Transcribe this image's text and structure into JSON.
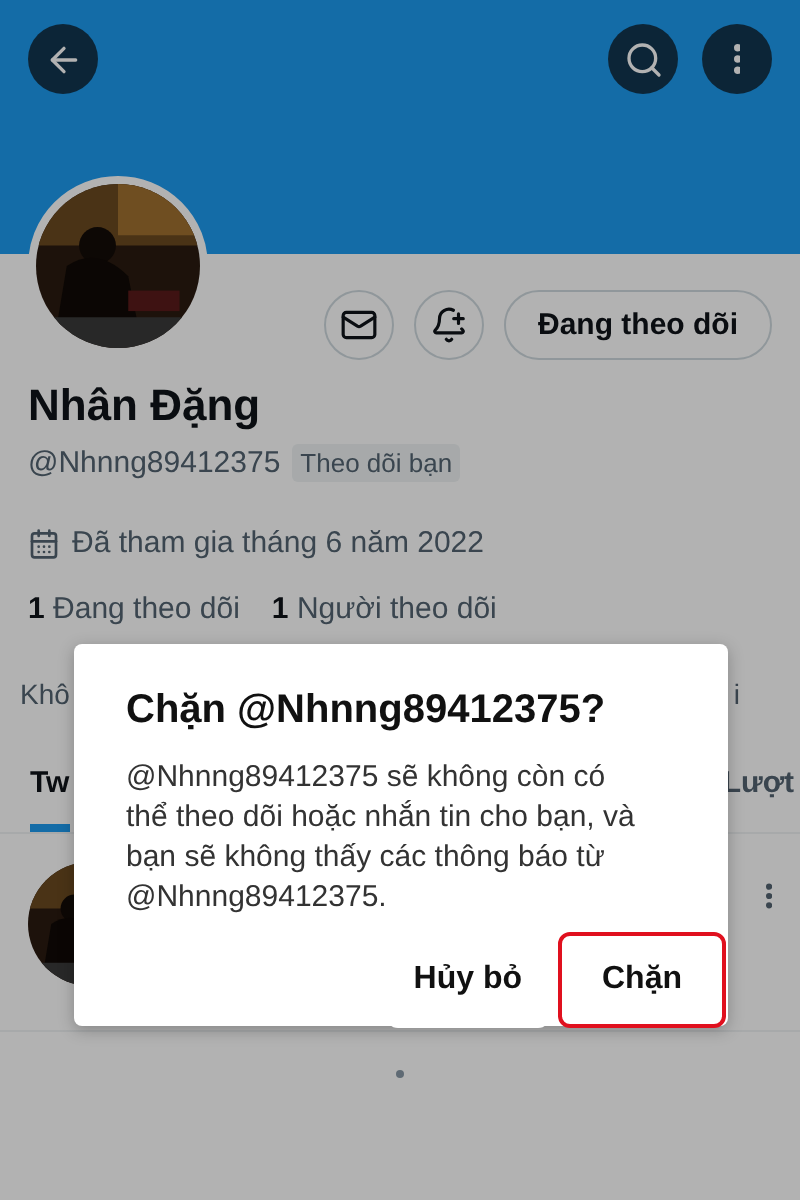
{
  "header": {
    "buttons": [
      {
        "kind": "back"
      },
      {
        "kind": "search"
      },
      {
        "kind": "more"
      }
    ]
  },
  "profile": {
    "actions": [
      {
        "kind": "message"
      },
      {
        "kind": "notify"
      }
    ],
    "follow_button": "Đang theo dõi",
    "name": "Nhân Đặng",
    "handle": "@Nhnng89412375",
    "follows_you_badge": "Theo dõi bạn",
    "joined": "Đã tham gia tháng 6 năm 2022",
    "stats": [
      {
        "count": "1",
        "label": "Đang theo dõi"
      },
      {
        "count": "1",
        "label": "Người theo dõi"
      }
    ],
    "note": {
      "start": "Khô",
      "end": "i"
    }
  },
  "tabs": [
    {
      "label": "Tw",
      "selected": true
    },
    {
      "label": "Lượt",
      "selected": false
    }
  ],
  "dialog": {
    "title": "Chặn @Nhnng89412375?",
    "message": "@Nhnng89412375 sẽ không còn có thể theo dõi hoặc nhắn tin cho bạn, và bạn sẽ không thấy các thông báo từ @Nhnng89412375.",
    "buttons": [
      {
        "label": "Hủy bỏ",
        "highlighted": false
      },
      {
        "label": "Chặn",
        "highlighted": true
      }
    ]
  }
}
